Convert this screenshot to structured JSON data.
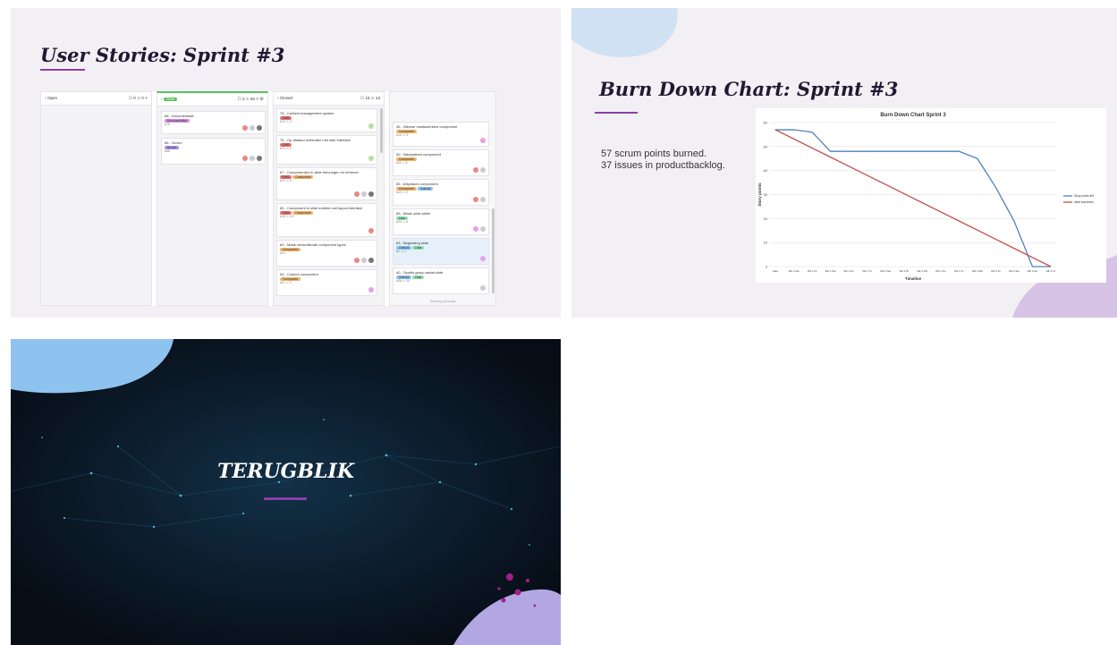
{
  "slide1": {
    "title": "User Stories: Sprint #3",
    "columns": [
      {
        "name": "Open",
        "counts": "☐ 0  ⚠ 0",
        "add": "+"
      },
      {
        "name": "Done",
        "counts": "☐ 3  ⚠ 60",
        "add": "+"
      },
      {
        "name": "Closed",
        "counts": "☐ 15  ⚠ 13",
        "add": ""
      }
    ],
    "done_cards": [
      {
        "title": "68 - Documentatie",
        "tags": [
          "Documentation"
        ],
        "meta": "#70"
      },
      {
        "title": "66 - Scrum",
        "tags": [
          "Scrum"
        ],
        "meta": "#66"
      }
    ],
    "closed_cards": [
      {
        "title": "75 - Content management system",
        "tags": [
          "CMS"
        ],
        "meta": "#74  ⚠ 2"
      },
      {
        "title": "75 - Op afstand verbinden met web interface",
        "tags": [
          "CMS"
        ],
        "meta": "#71  ⚠ 2"
      },
      {
        "title": "67 - Componenten in slide toevoegen en beheren",
        "tags": [
          "CMS",
          "Component"
        ],
        "meta": "#72  ⚠ 5"
      },
      {
        "title": "65 - Component in slide indelen met layout interface",
        "tags": [
          "CMS",
          "Component"
        ],
        "meta": "#15  ⚠ 13"
      },
      {
        "title": "63 - Maak verschillende component types",
        "tags": [
          "Component"
        ],
        "meta": "#14"
      },
      {
        "title": "53 - Custom component",
        "tags": [
          "Component"
        ],
        "meta": "#17  ⚠ 2"
      }
    ],
    "extra_cards": [
      {
        "title": "45 - Nieuwe mediawerkers component",
        "tags": [
          "Component"
        ],
        "meta": "#10  ⚠ 3"
      },
      {
        "title": "50 - Nieuwsfeed component",
        "tags": [
          "Component"
        ],
        "meta": "#22  ⚠ 2"
      },
      {
        "title": "55 - Afspraken component",
        "tags": [
          "Component",
          "Outlook"
        ],
        "meta": "#12  ⚠ 2"
      },
      {
        "title": "65 - Maak ontle slider",
        "tags": [
          "Data"
        ],
        "meta": "#24  ⚠ 5"
      },
      {
        "title": "63 - Beginsting slide",
        "tags": [
          "Outlook",
          "Data"
        ],
        "meta": "#2  ⚠ 1"
      },
      {
        "title": "40 - Spotify group assist slide",
        "tags": [
          "Outlook",
          "Data"
        ],
        "meta": "#28  ⚠ 20"
      }
    ],
    "footer": "Showing all issues"
  },
  "slide2": {
    "title": "Burn Down Chart: Sprint #3",
    "line1": "57 scrum points burned.",
    "line2": "37 issues in productbacklog."
  },
  "chart_data": {
    "type": "line",
    "title": "Burn Down Chart Sprint 3",
    "xlabel": "Timeline",
    "ylabel": "Story points",
    "categories": [
      "Start",
      "Wk 1 Ma",
      "Wk 1 Di",
      "Wk 1 Wo",
      "Wk 1 Do",
      "Wk 1 Vr",
      "Wk 2 Ma",
      "Wk 2 Di",
      "Wk 2 Wo",
      "Wk 2 Do",
      "Wk 2 Vr",
      "Wk 3 Ma",
      "Wk 3 Di",
      "Wk 3 Wo",
      "Wk 3 Do",
      "Wk 3 Vr"
    ],
    "yticks": [
      0,
      10,
      20,
      30,
      40,
      50,
      60
    ],
    "ylim": [
      0,
      60
    ],
    "grid": true,
    "legend": "right",
    "series": [
      {
        "name": "Story points left",
        "color": "#4f81bd",
        "values": [
          57,
          57,
          56,
          48,
          48,
          48,
          48,
          48,
          48,
          48,
          48,
          45,
          33,
          19,
          0,
          0
        ]
      },
      {
        "name": "Ideal burndown",
        "color": "#c0504d",
        "values": [
          57,
          53.2,
          49.4,
          45.6,
          41.8,
          38,
          34.2,
          30.4,
          26.6,
          22.8,
          19,
          15.2,
          11.4,
          7.6,
          3.8,
          0
        ]
      }
    ]
  },
  "slide3": {
    "title": "TERUGBLIK"
  }
}
